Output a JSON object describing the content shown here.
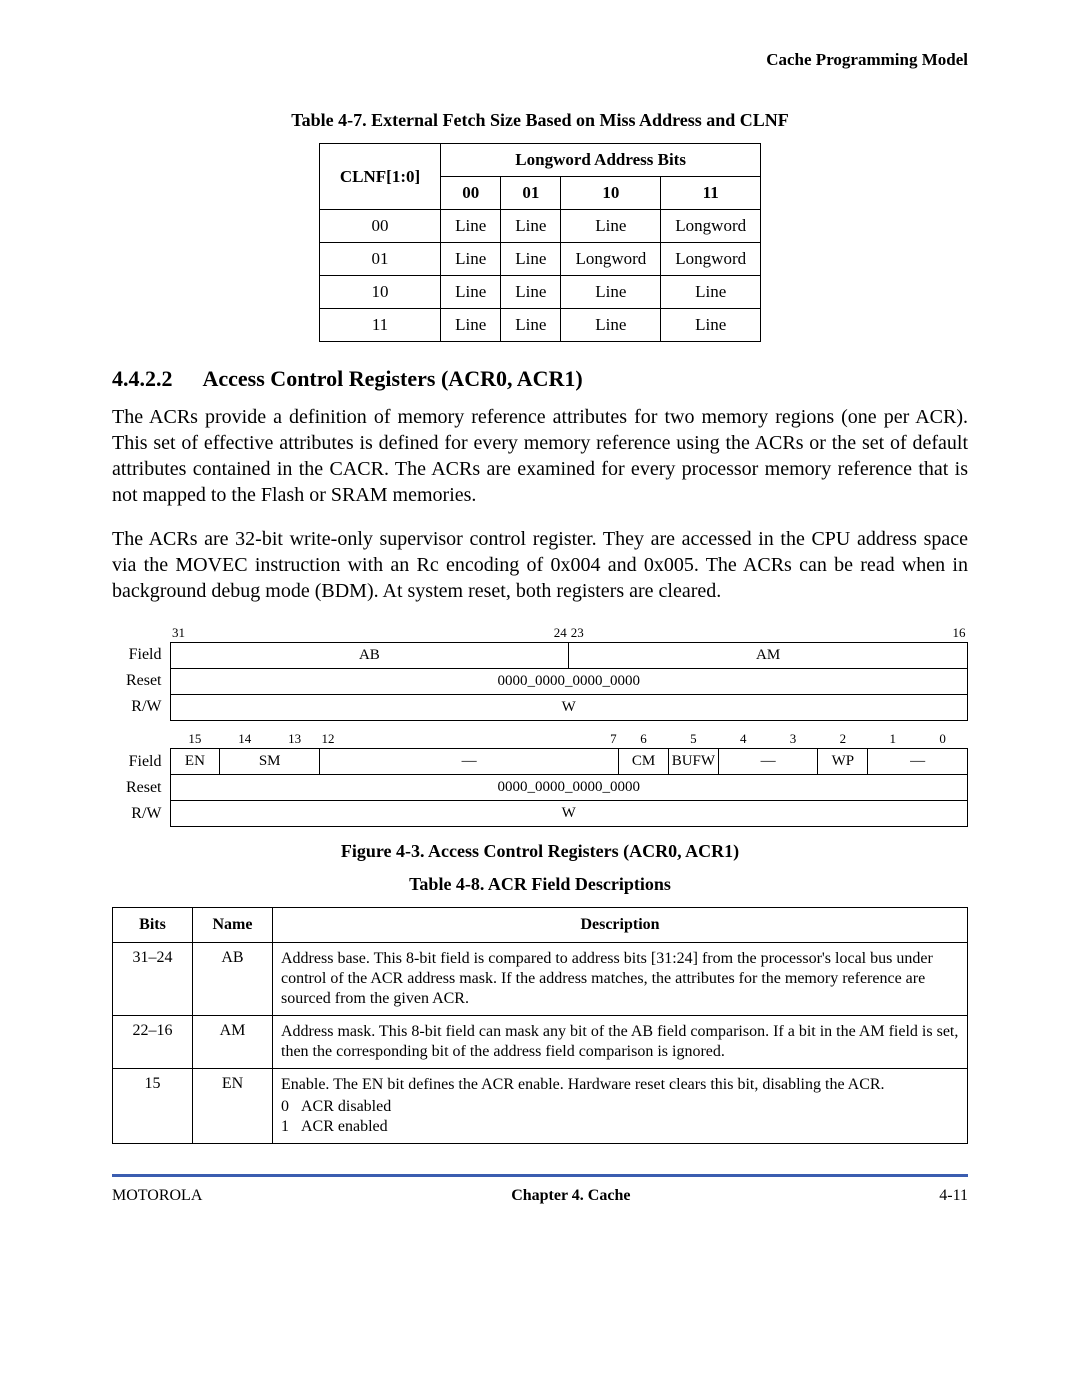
{
  "header": {
    "section": "Cache Programming Model"
  },
  "table47": {
    "caption": "Table 4-7. External Fetch Size Based on Miss Address and CLNF",
    "colgroup_header": "Longword Address Bits",
    "row_header": "CLNF[1:0]",
    "cols": [
      "00",
      "01",
      "10",
      "11"
    ],
    "rows": [
      {
        "label": "00",
        "cells": [
          "Line",
          "Line",
          "Line",
          "Longword"
        ]
      },
      {
        "label": "01",
        "cells": [
          "Line",
          "Line",
          "Longword",
          "Longword"
        ]
      },
      {
        "label": "10",
        "cells": [
          "Line",
          "Line",
          "Line",
          "Line"
        ]
      },
      {
        "label": "11",
        "cells": [
          "Line",
          "Line",
          "Line",
          "Line"
        ]
      }
    ]
  },
  "section": {
    "number": "4.4.2.2",
    "title": "Access Control Registers (ACR0, ACR1)",
    "para1": "The ACRs provide a definition of memory reference attributes for two memory regions (one per ACR). This set of effective attributes is defined for every memory reference using the ACRs or the set of default attributes contained in the CACR. The ACRs are examined for every processor memory reference that is not mapped to the Flash or SRAM memories.",
    "para2": "The ACRs are 32-bit write-only supervisor control register. They are accessed in the CPU address space via the MOVEC instruction with an Rc encoding of 0x004 and 0x005. The ACRs can be read when in background debug mode (BDM). At system reset, both registers are cleared."
  },
  "fig43": {
    "caption": "Figure 4-3. Access Control Registers (ACR0, ACR1)",
    "row_labels": {
      "field": "Field",
      "reset": "Reset",
      "rw": "R/W"
    },
    "top": {
      "bit_hi": "31",
      "bit_split_l": "24",
      "bit_split_r": "23",
      "bit_lo": "16",
      "field1": "AB",
      "field2": "AM",
      "reset": "0000_0000_0000_0000",
      "rw": "W"
    },
    "bottom": {
      "bits": [
        "15",
        "14",
        "13",
        "12",
        "7",
        "6",
        "5",
        "4",
        "3",
        "2",
        "1",
        "0"
      ],
      "fields": [
        "EN",
        "SM",
        "—",
        "CM",
        "BUFW",
        "—",
        "WP",
        "—"
      ],
      "reset": "0000_0000_0000_0000",
      "rw": "W"
    }
  },
  "table48": {
    "caption": "Table 4-8. ACR Field Descriptions",
    "headers": [
      "Bits",
      "Name",
      "Description"
    ],
    "rows": [
      {
        "bits": "31–24",
        "name": "AB",
        "desc": "Address base. This 8-bit field is compared to address bits [31:24] from the processor's local bus under control of the ACR address mask. If the address matches, the attributes for the memory reference are sourced from the given ACR."
      },
      {
        "bits": "22–16",
        "name": "AM",
        "desc": "Address mask. This 8-bit field can mask any bit of the AB field comparison. If a bit in the AM field is set, then the corresponding bit of the address field comparison is ignored."
      },
      {
        "bits": "15",
        "name": "EN",
        "desc": "Enable. The EN bit defines the ACR enable. Hardware reset clears this bit, disabling the ACR.",
        "codes": [
          {
            "k": "0",
            "v": "ACR disabled"
          },
          {
            "k": "1",
            "v": "ACR enabled"
          }
        ]
      }
    ]
  },
  "footer": {
    "left": "MOTOROLA",
    "center": "Chapter 4. Cache",
    "right": "4-11"
  }
}
